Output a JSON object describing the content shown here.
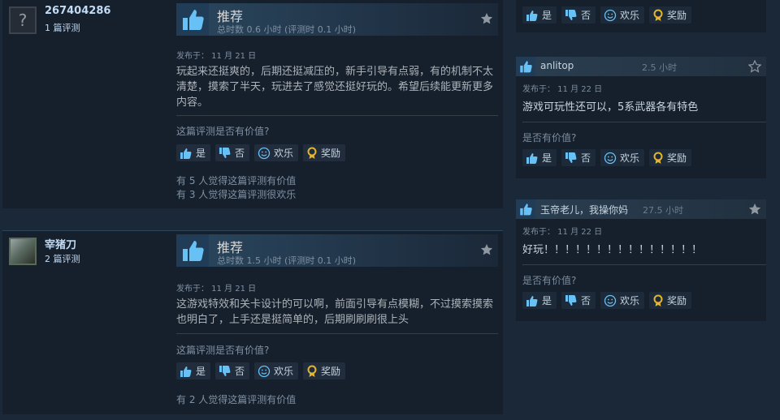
{
  "reviews": [
    {
      "author_name": "267404286",
      "review_count": "1 篇评测",
      "avatar_glyph": "?",
      "verdict": "推荐",
      "hours": "总时数 0.6 小时   (评测时 0.1 小时)",
      "posted": "发布于：  11 月 21 日",
      "text": "玩起来还挺爽的，后期还挺减压的，新手引导有点弱，有的机制不太清楚，摸索了半天，玩进去了感觉还挺好玩的。希望后续能更新更多内容。",
      "helpful_question": "这篇评测是否有价值?",
      "stats": [
        "有 5 人觉得这篇评测有价值",
        "有 3 人觉得这篇评测很欢乐"
      ]
    },
    {
      "author_name": "宰猪刀",
      "review_count": "2 篇评测",
      "verdict": "推荐",
      "hours": "总时数 1.5 小时   (评测时 0.1 小时)",
      "posted": "发布于：  11 月 21 日",
      "text": "这游戏特效和关卡设计的可以啊，前面引导有点模糊，不过摸索摸索也明白了，上手还是挺简单的，后期刷刷刷很上头",
      "helpful_question": "这篇评测是否有价值?",
      "stats": [
        "有 2 人觉得这篇评测有价值"
      ]
    }
  ],
  "side_reviews": [
    {
      "name": "anlitop",
      "hours": "2.5 小时",
      "posted": "发布于：  11 月 22 日",
      "text": "游戏可玩性还可以，5系武器各有特色",
      "helpful_question": "是否有价值?"
    },
    {
      "name": "玉帝老儿，我操你妈",
      "hours": "27.5 小时",
      "posted": "发布于：  11 月 22 日",
      "text": "好玩！！！！！！！！！！！！！！！",
      "helpful_question": "是否有价值?"
    }
  ],
  "buttons": {
    "yes": "是",
    "no": "否",
    "funny": "欢乐",
    "award": "奖励"
  },
  "icons": [
    "thumbs-up-icon",
    "thumbs-down-icon",
    "smiley-icon",
    "award-icon",
    "star-icon"
  ],
  "colors": {
    "background": "#1b2838",
    "panel": "#16202d",
    "accent": "#66c0f4",
    "award": "#e6b52e"
  }
}
